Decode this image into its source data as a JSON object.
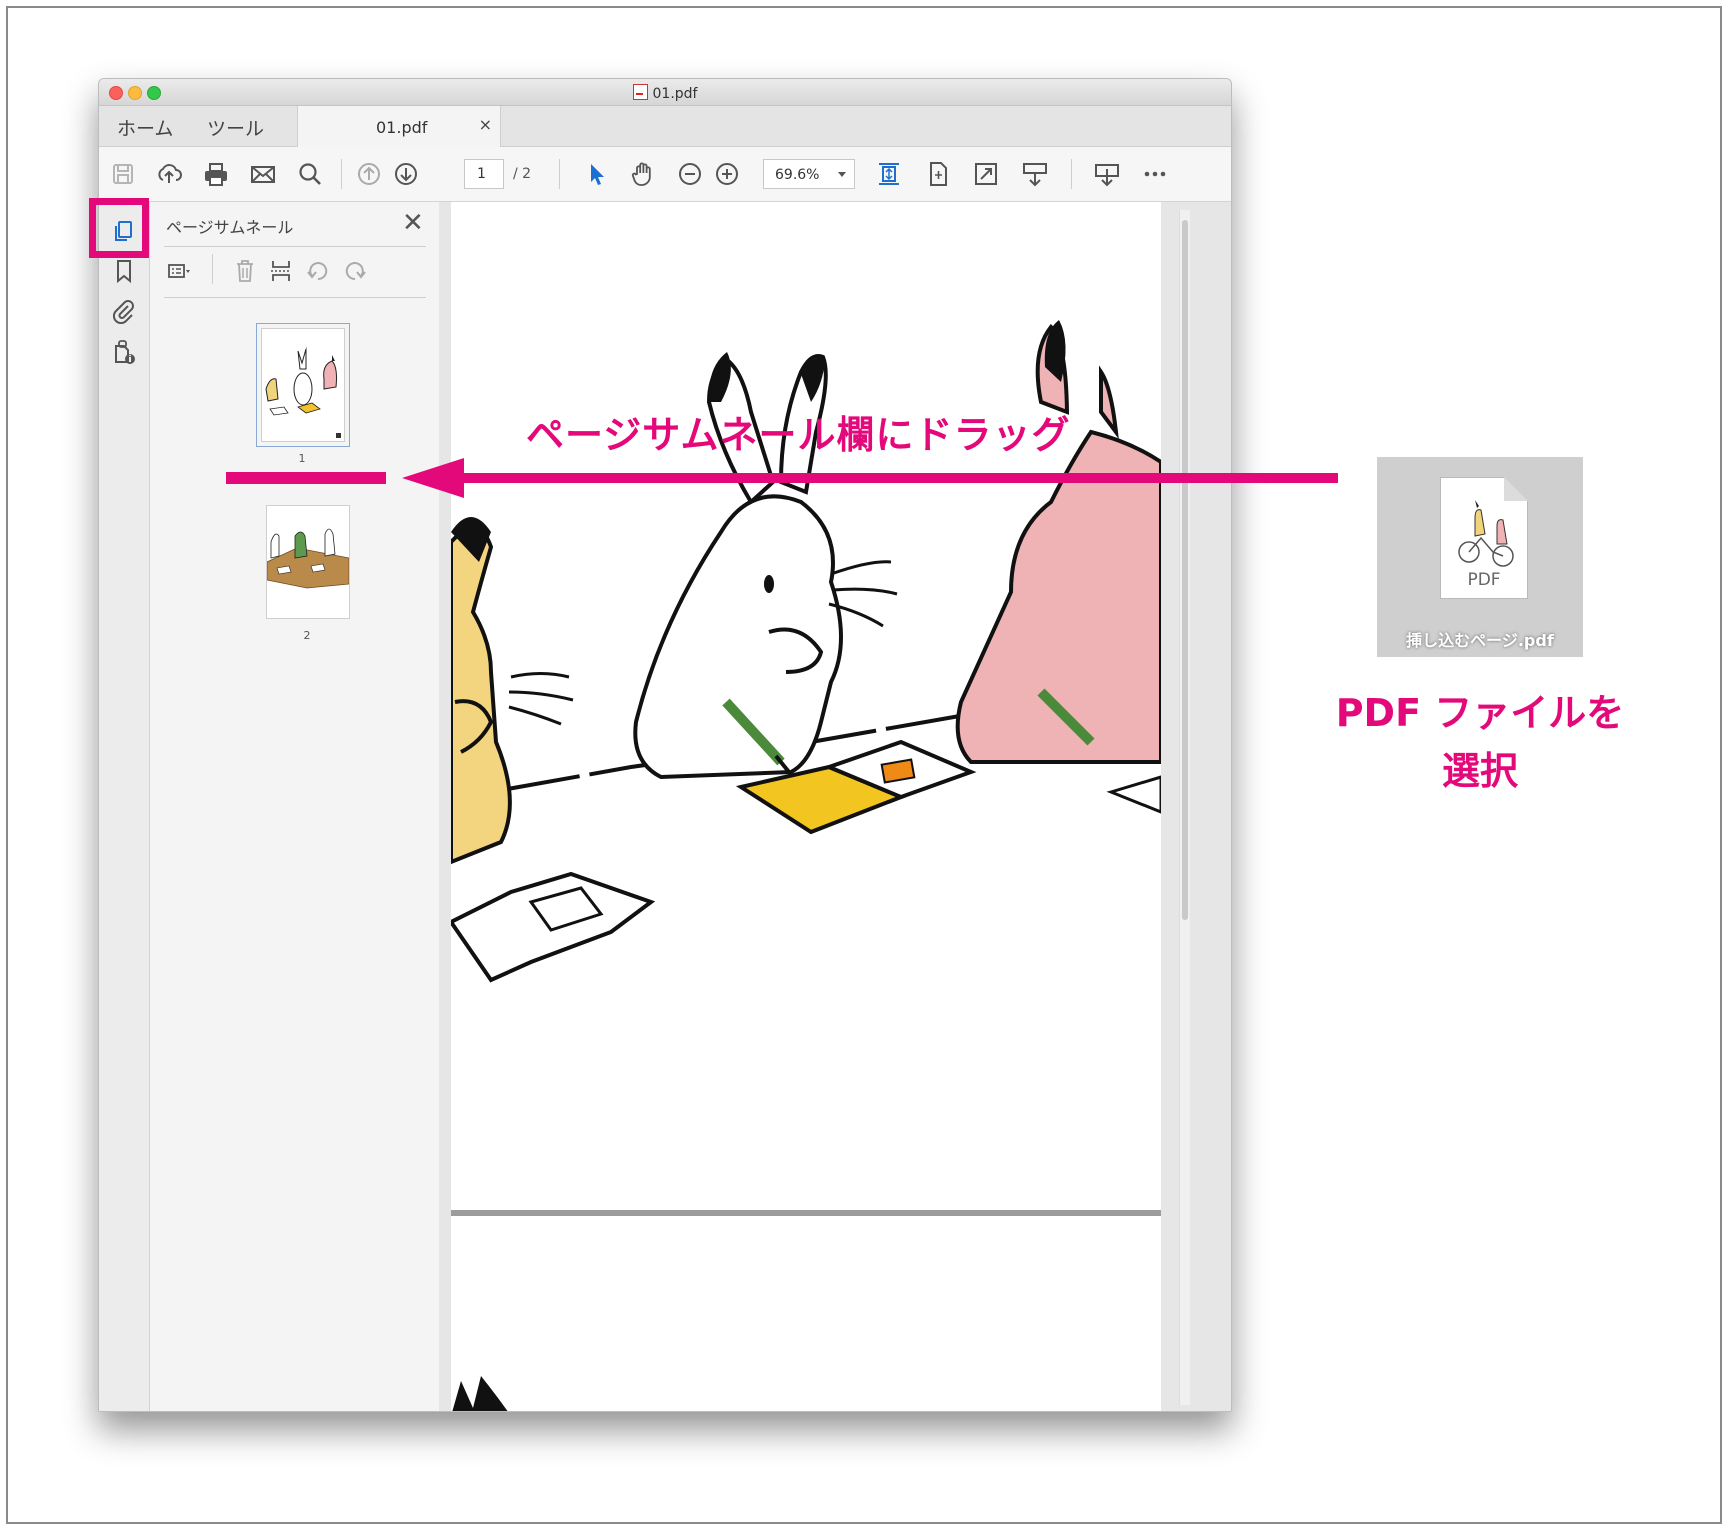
{
  "window": {
    "title": "01.pdf"
  },
  "tabs": {
    "home": "ホーム",
    "tools": "ツール",
    "document": "01.pdf",
    "close": "×"
  },
  "toolbar": {
    "page_current": "1",
    "page_total": "/ 2",
    "zoom": "69.6%",
    "icons": [
      "save-icon",
      "upload-icon",
      "print-icon",
      "mail-icon",
      "search-icon",
      "prev-page-icon",
      "next-page-icon",
      "select-arrow-icon",
      "hand-icon",
      "zoom-out-icon",
      "zoom-in-icon",
      "fit-page-icon",
      "rotate-page-icon",
      "fullscreen-icon",
      "scroll-mode-icon",
      "share-icon",
      "more-icon"
    ]
  },
  "thumbnail_panel": {
    "title": "ページサムネール",
    "close": "✕",
    "thumbnails": [
      {
        "label": "1"
      },
      {
        "label": "2"
      }
    ]
  },
  "annotations": {
    "drag_instruction": "ページサムネール欄にドラッグ",
    "file_name": "挿し込むページ.pdf",
    "file_type": "PDF",
    "select_instruction_line1": "PDF ファイルを",
    "select_instruction_line2": "選択",
    "accent_color": "#e4097a"
  }
}
